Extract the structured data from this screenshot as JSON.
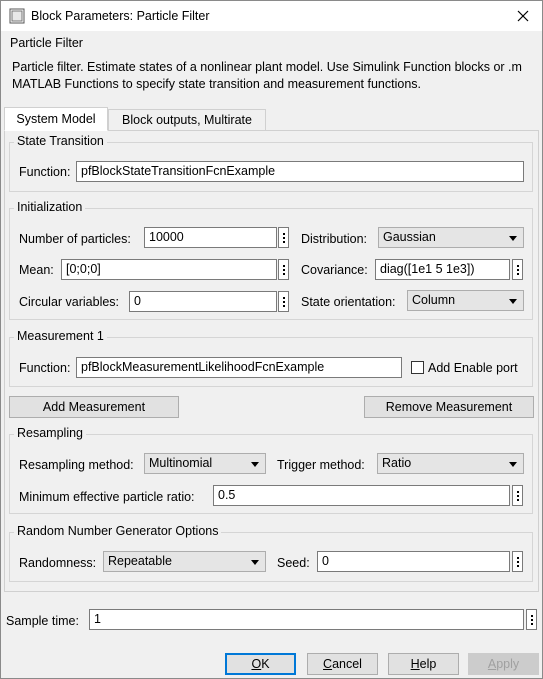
{
  "window": {
    "title": "Block Parameters: Particle Filter"
  },
  "header": {
    "group_title": "Particle Filter",
    "description": "Particle filter. Estimate states of a nonlinear plant model. Use Simulink Function blocks or .m MATLAB Functions to specify state transition and measurement functions."
  },
  "tabs": [
    {
      "label": "System Model",
      "active": true
    },
    {
      "label": "Block outputs, Multirate",
      "active": false
    }
  ],
  "state_transition": {
    "title": "State Transition",
    "function_label": "Function:",
    "function_value": "pfBlockStateTransitionFcnExample"
  },
  "initialization": {
    "title": "Initialization",
    "num_particles_label": "Number of particles:",
    "num_particles_value": "10000",
    "distribution_label": "Distribution:",
    "distribution_value": "Gaussian",
    "mean_label": "Mean:",
    "mean_value": "[0;0;0]",
    "covariance_label": "Covariance:",
    "covariance_value": "diag([1e1 5 1e3])",
    "circular_label": "Circular variables:",
    "circular_value": "0",
    "orientation_label": "State orientation:",
    "orientation_value": "Column"
  },
  "measurement": {
    "title": "Measurement 1",
    "function_label": "Function:",
    "function_value": "pfBlockMeasurementLikelihoodFcnExample",
    "enable_port_label": "Add Enable port",
    "enable_port_checked": false
  },
  "buttons": {
    "add_measurement": "Add Measurement",
    "remove_measurement": "Remove Measurement"
  },
  "resampling": {
    "title": "Resampling",
    "method_label": "Resampling method:",
    "method_value": "Multinomial",
    "trigger_label": "Trigger method:",
    "trigger_value": "Ratio",
    "ratio_label": "Minimum effective particle ratio:",
    "ratio_value": "0.5"
  },
  "rng": {
    "title": "Random Number Generator Options",
    "randomness_label": "Randomness:",
    "randomness_value": "Repeatable",
    "seed_label": "Seed:",
    "seed_value": "0"
  },
  "sample_time": {
    "label": "Sample time:",
    "value": "1"
  },
  "footer": {
    "ok": "OK",
    "ok_ul": "O",
    "ok_rest": "K",
    "cancel_ul": "C",
    "cancel_rest": "ancel",
    "help_ul": "H",
    "help_rest": "elp",
    "apply_ul": "A",
    "apply_rest": "pply"
  },
  "colors": {
    "accent": "#0078d7",
    "window_bg": "#f0f0f0",
    "disabled_text": "#a0a0a0"
  },
  "icons": {
    "app": "simulink-block-icon",
    "close": "close-icon",
    "menu": "kebab-menu-icon",
    "dropdown": "chevron-down-icon"
  }
}
